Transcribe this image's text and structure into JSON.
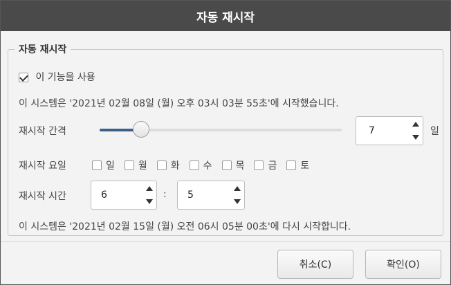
{
  "window": {
    "title": "자동 재시작"
  },
  "group": {
    "title": "자동 재시작"
  },
  "enable": {
    "label": "이 기능을 사용",
    "checked": true
  },
  "started_text": "이 시스템은 '2021년 02월 08일 (월) 오후 03시 03분 55초'에 시작했습니다.",
  "interval": {
    "label": "재시작 간격",
    "value": "7",
    "unit": "일",
    "slider_fraction": 0.17
  },
  "days": {
    "label": "재시작 요일",
    "items": [
      {
        "label": "일",
        "checked": false
      },
      {
        "label": "월",
        "checked": false
      },
      {
        "label": "화",
        "checked": false
      },
      {
        "label": "수",
        "checked": false
      },
      {
        "label": "목",
        "checked": false
      },
      {
        "label": "금",
        "checked": false
      },
      {
        "label": "토",
        "checked": false
      }
    ]
  },
  "time": {
    "label": "재시작 시간",
    "hour": "6",
    "separator": ":",
    "minute": "5"
  },
  "next_text": "이 시스템은 '2021년 02월 15일 (월) 오전 06시 05분 00초'에 다시 시작합니다.",
  "buttons": {
    "cancel": "취소(C)",
    "ok": "확인(O)"
  },
  "colors": {
    "titlebar": "#4a4a4a",
    "slider_fill": "#3c5f86"
  }
}
